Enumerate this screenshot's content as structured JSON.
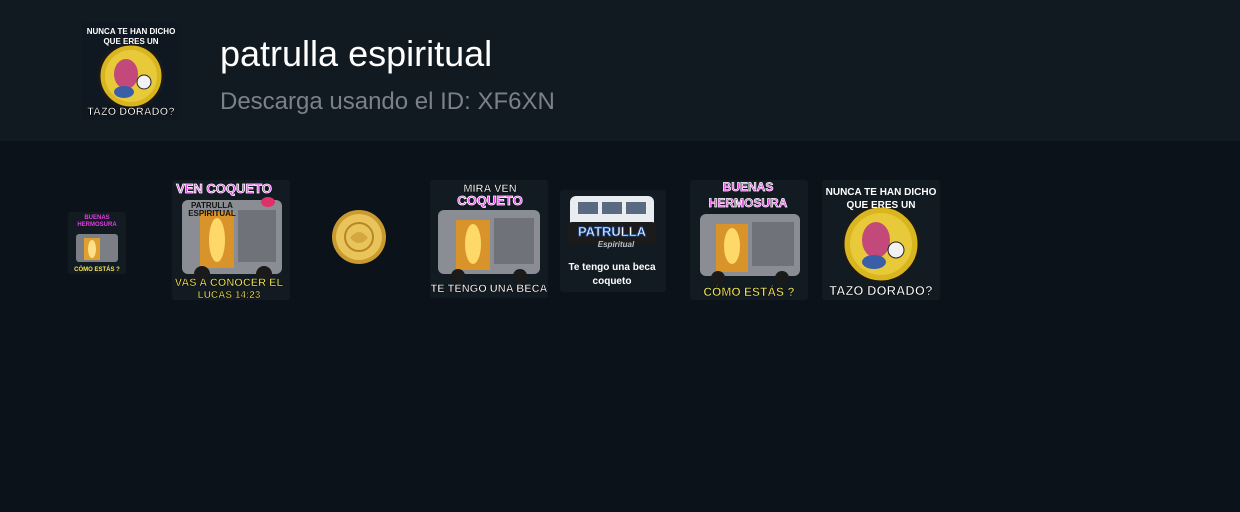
{
  "pack": {
    "title": "patrulla espiritual",
    "subtitle": "Descarga usando el ID: XF6XN",
    "icon": {
      "line1": "NUNCA TE HAN DICHO",
      "line2": "QUE ERES UN",
      "bottom": "TAZO DORADO?"
    }
  },
  "stickers": [
    {
      "top1": "BUENAS",
      "top2": "HERMOSURA",
      "bottom": "CÓMO ESTÁS ?"
    },
    {
      "top": "VEN COQUETO",
      "bottom1": "VAS A CONOCER EL",
      "bottom2": "LUCAS 14:23"
    },
    {
      "coin_icon": "gold-coin-icon"
    },
    {
      "top1": "MIRA VEN",
      "top2": "COQUETO",
      "bottom": "TE TENGO UNA BECA"
    },
    {
      "logo": "PATRULLA",
      "logo_script": "Espiritual",
      "caption1": "Te tengo una beca",
      "caption2": "coqueto"
    },
    {
      "top1": "BUENAS",
      "top2": "HERMOSURA",
      "bottom": "CÓMO ESTÁS ?"
    },
    {
      "line1": "NUNCA TE HAN DICHO",
      "line2": "QUE ERES UN",
      "bottom": "TAZO DORADO?"
    }
  ],
  "van_text": {
    "patrulla": "PATRULLA",
    "espiritual": "ESPIRITUAL"
  },
  "colors": {
    "header_bg": "#121a21",
    "page_bg": "#0b1219",
    "title": "#ffffff",
    "subtitle": "#7a8188",
    "magenta": "#e03ce0",
    "gold": "#e6c230"
  }
}
